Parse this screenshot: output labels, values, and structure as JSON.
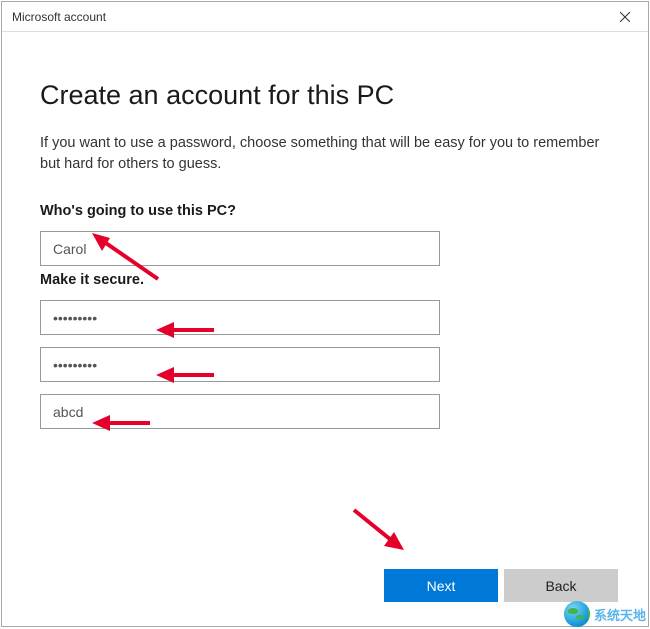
{
  "window": {
    "title": "Microsoft account"
  },
  "heading": "Create an account for this PC",
  "description": "If you want to use a password, choose something that will be easy for you to remember but hard for others to guess.",
  "sections": {
    "username_label": "Who's going to use this PC?",
    "security_label": "Make it secure."
  },
  "fields": {
    "username": "Carol",
    "password": "•••••••••",
    "confirm_password": "•••••••••",
    "hint": "abcd"
  },
  "buttons": {
    "next": "Next",
    "back": "Back"
  },
  "watermark": "系统天地"
}
